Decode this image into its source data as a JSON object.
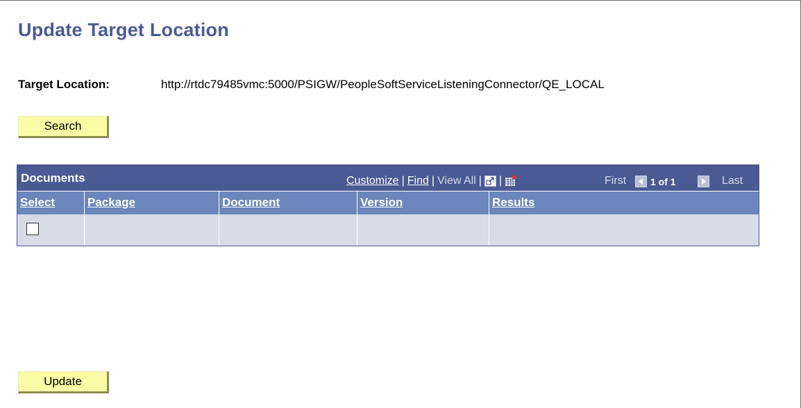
{
  "page": {
    "title": "Update Target Location"
  },
  "target": {
    "label": "Target Location:",
    "value": "http://rtdc79485vmc:5000/PSIGW/PeopleSoftServiceListeningConnector/QE_LOCAL"
  },
  "buttons": {
    "search_label": "Search",
    "update_label": "Update"
  },
  "grid": {
    "title": "Documents",
    "tools": {
      "customize": "Customize",
      "find": "Find",
      "view_all": "View All",
      "separator": "|"
    },
    "nav": {
      "first": "First",
      "count": "1 of 1",
      "last": "Last"
    },
    "columns": [
      "Select",
      "Package",
      "Document",
      "Version",
      "Results"
    ],
    "rows": [
      {
        "select": false,
        "package": "",
        "document": "",
        "version": "",
        "results": ""
      }
    ],
    "colors": {
      "header": "#4a5a93",
      "column_header": "#6b86ba",
      "row": "#d8dce7",
      "button": "#fdfca6"
    }
  },
  "icons": {
    "zoom": "zoom-grid-icon",
    "download": "download-to-excel-icon",
    "first": "first-arrow-icon",
    "next": "next-arrow-icon"
  }
}
